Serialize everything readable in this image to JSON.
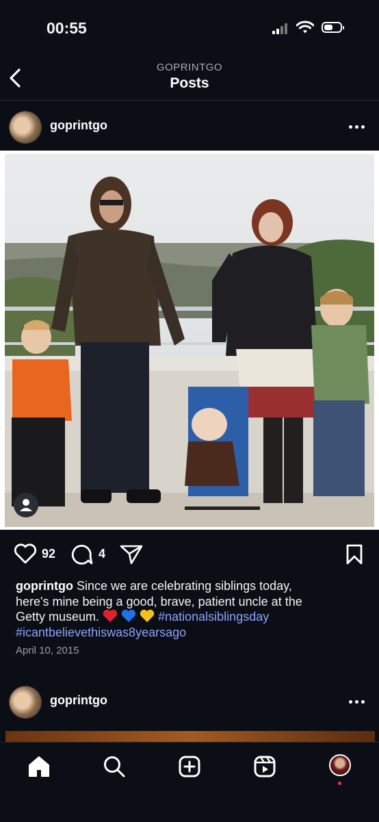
{
  "status_bar": {
    "time": "00:55"
  },
  "header": {
    "account": "GOPRINTGO",
    "title": "Posts"
  },
  "post": {
    "username": "goprintgo",
    "likes": "92",
    "comments": "4",
    "caption_user": "goprintgo",
    "caption_line1": "Since we are celebrating siblings today,",
    "caption_line2": "here's mine being a good, brave, patient uncle at the",
    "caption_line3": "Getty museum.",
    "caption_emojis": [
      "red-heart",
      "blue-heart",
      "yellow-heart"
    ],
    "hashtag1": "#nationalsiblingsday",
    "hashtag2": "#icantbelievethiswas8yearsago",
    "date": "April 10, 2015"
  },
  "next_post": {
    "username": "goprintgo"
  },
  "tab_bar": {
    "items": [
      "home-icon",
      "search-icon",
      "create-icon",
      "reels-icon",
      "profile-avatar"
    ]
  },
  "colors": {
    "background": "#0b0e14",
    "hashtag": "#8ea2ff",
    "notification": "#ff3040"
  }
}
